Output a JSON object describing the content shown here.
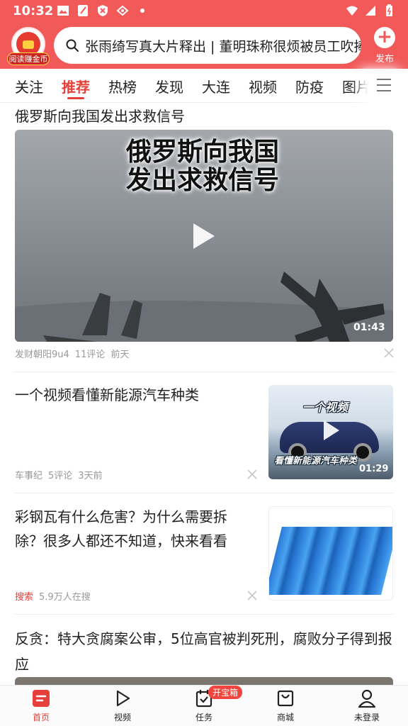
{
  "colors": {
    "brand_red": "#f25a5a",
    "accent": "#e6403b",
    "meta_gray": "#999999"
  },
  "status_bar": {
    "time": "10:32",
    "left_icons": [
      "image-icon",
      "note-icon",
      "shield-icon",
      "vpn-icon",
      "dot-icon"
    ],
    "right_icons": [
      "wifi-icon",
      "signal-icon",
      "battery-icon"
    ]
  },
  "header": {
    "avatar_badge": "阅读赚金币",
    "search_text": "张雨绮写真大片释出 | 董明珠称很烦被员工吹捧",
    "publish_label": "发布"
  },
  "tabs": {
    "items": [
      "关注",
      "推荐",
      "热榜",
      "发现",
      "大连",
      "视频",
      "防疫",
      "图片"
    ],
    "active": "推荐",
    "more_icon": "menu-icon"
  },
  "feed": {
    "item1": {
      "title": "俄罗斯向我国发出求救信号",
      "video_caption": "俄罗斯向我国发出求救信号",
      "duration": "01:43",
      "source": "发财朝阳9u4",
      "comments": "11评论",
      "time": "前天"
    },
    "item2": {
      "title": "一个视频看懂新能源汽车种类",
      "thumb_top": "一个视频",
      "thumb_bottom": "看懂新能源汽车种类",
      "duration": "01:29",
      "source": "车事纪",
      "comments": "5评论",
      "time": "3天前"
    },
    "item3": {
      "title": "彩钢瓦有什么危害？为什么需要拆除？很多人都还不知道，快来看看",
      "tag": "搜索",
      "searching": "5.9万人在搜"
    },
    "item4": {
      "title": "反贪：特大贪腐案公审，5位高官被判死刑，腐败分子得到报应"
    }
  },
  "bottom_nav": {
    "items": [
      {
        "label": "首页",
        "icon": "home-icon"
      },
      {
        "label": "视频",
        "icon": "play-icon"
      },
      {
        "label": "任务",
        "icon": "calendar-check-icon"
      },
      {
        "label": "商城",
        "icon": "shopping-bag-icon"
      },
      {
        "label": "未登录",
        "icon": "user-icon"
      }
    ],
    "active": "首页",
    "task_badge": "开宝箱"
  }
}
